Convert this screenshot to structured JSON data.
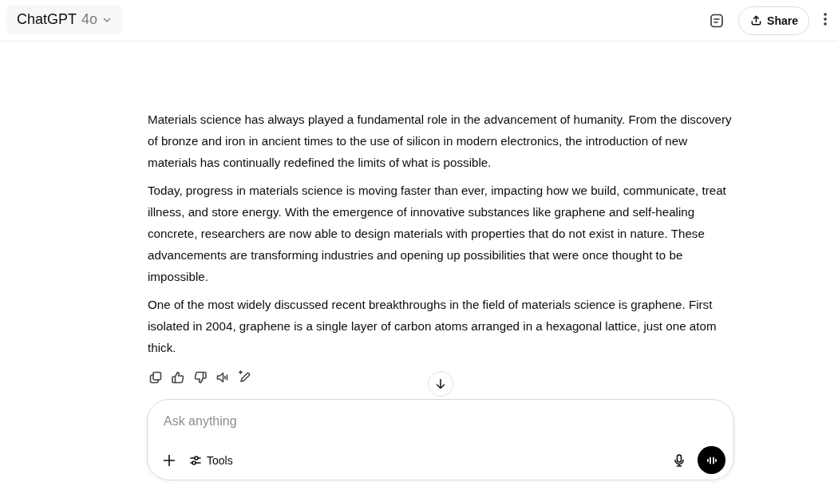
{
  "header": {
    "model_name": "ChatGPT",
    "model_version": "4o",
    "share_label": "Share"
  },
  "message": {
    "paragraphs": [
      "Materials science has always played a fundamental role in the advancement of humanity. From the discovery of bronze and iron in ancient times to the use of silicon in modern electronics, the introduction of new materials has continually redefined the limits of what is possible.",
      "Today, progress in materials science is moving faster than ever, impacting how we build, communicate, treat illness, and store energy. With the emergence of innovative substances like graphene and self-healing concrete, researchers are now able to design materials with properties that do not exist in nature. These advancements are transforming industries and opening up possibilities that were once thought to be impossible.",
      "One of the most widely discussed recent breakthroughs in the field of materials science is graphene. First isolated in 2004, graphene is a single layer of carbon atoms arranged in a hexagonal lattice, just one atom thick."
    ]
  },
  "composer": {
    "placeholder": "Ask anything",
    "tools_label": "Tools"
  }
}
